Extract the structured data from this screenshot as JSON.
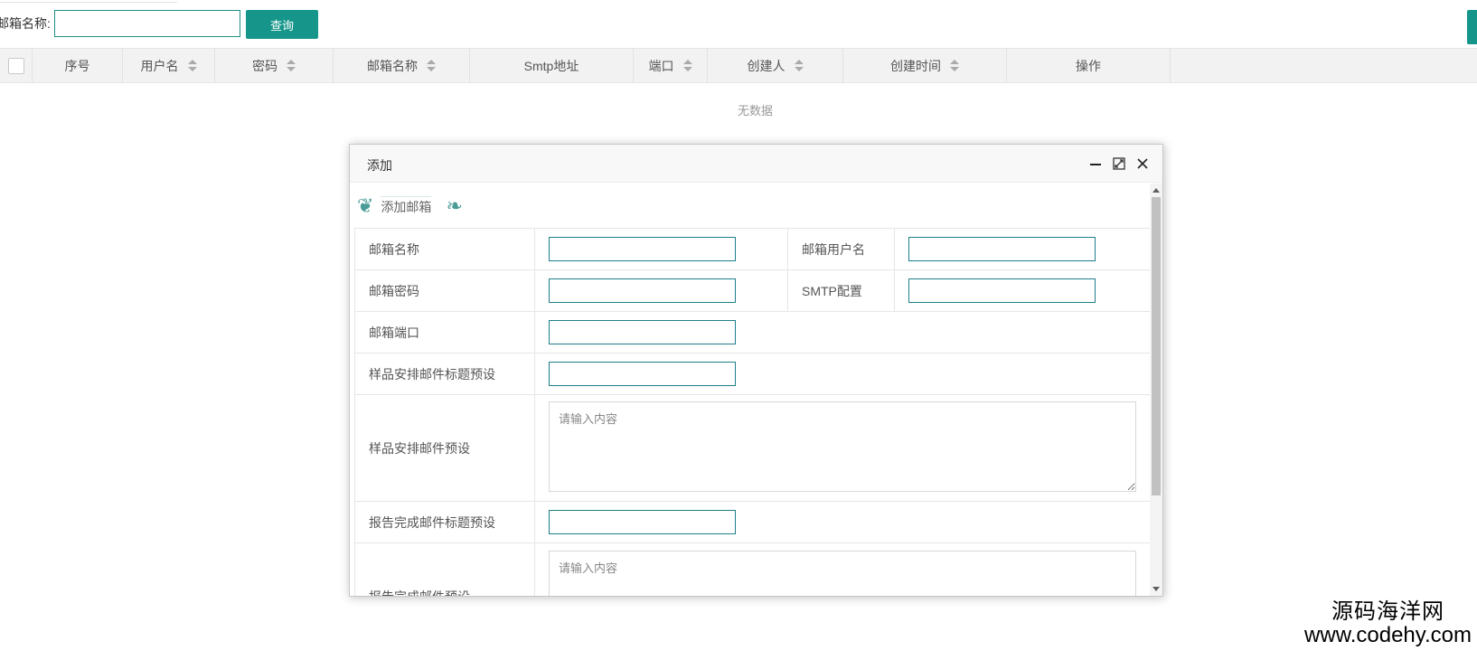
{
  "search": {
    "label": "邮箱名称:",
    "value": "",
    "button_label": "查询"
  },
  "grid": {
    "columns": [
      {
        "label": "序号",
        "sortable": false
      },
      {
        "label": "用户名",
        "sortable": true
      },
      {
        "label": "密码",
        "sortable": true
      },
      {
        "label": "邮箱名称",
        "sortable": true
      },
      {
        "label": "Smtp地址",
        "sortable": false
      },
      {
        "label": "端口",
        "sortable": true
      },
      {
        "label": "创建人",
        "sortable": true
      },
      {
        "label": "创建时间",
        "sortable": true
      },
      {
        "label": "操作",
        "sortable": false
      }
    ],
    "empty_text": "无数据"
  },
  "modal": {
    "title": "添加",
    "icons": [
      "minimize-icon",
      "maximize-icon",
      "close-icon"
    ],
    "section_title": "添加邮箱",
    "fields": {
      "mail_name": "邮箱名称",
      "mail_user": "邮箱用户名",
      "mail_password": "邮箱密码",
      "smtp_config": "SMTP配置",
      "mail_port": "邮箱端口",
      "sample_subject": "样品安排邮件标题预设",
      "sample_body": "样品安排邮件预设",
      "report_subject": "报告完成邮件标题预设",
      "report_body": "报告完成邮件预设"
    },
    "textarea_placeholder": "请输入内容"
  },
  "watermark": {
    "line1": "源码海洋网",
    "line2": "www.codehy.com"
  },
  "colors": {
    "accent": "#16968a",
    "input_border": "#1e7f8a"
  }
}
